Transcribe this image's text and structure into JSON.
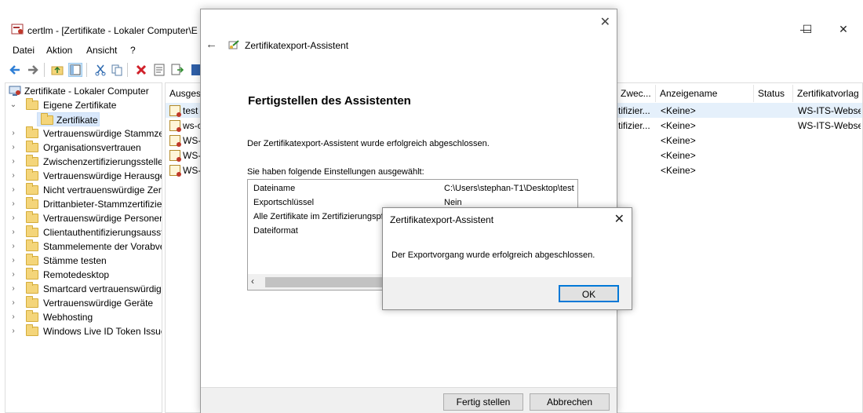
{
  "window": {
    "title": "certlm - [Zertifikate - Lokaler Computer\\E",
    "minimize": "—",
    "maximize": "☐",
    "close": "✕"
  },
  "menu": [
    "Datei",
    "Aktion",
    "Ansicht",
    "?"
  ],
  "tree": {
    "root": "Zertifikate - Lokaler Computer",
    "items": [
      {
        "label": "Eigene Zertifikate",
        "expanded": true
      },
      {
        "label": "Zertifikate",
        "child": true,
        "selected": true
      },
      {
        "label": "Vertrauenswürdige Stammzer"
      },
      {
        "label": "Organisationsvertrauen"
      },
      {
        "label": "Zwischenzertifizierungsstellen"
      },
      {
        "label": "Vertrauenswürdige Herausgeb"
      },
      {
        "label": "Nicht vertrauenswürdige Zerti"
      },
      {
        "label": "Drittanbieter-Stammzertifizie"
      },
      {
        "label": "Vertrauenswürdige Personen"
      },
      {
        "label": "Clientauthentifizierungsausst"
      },
      {
        "label": "Stammelemente der Vorabve"
      },
      {
        "label": "Stämme testen"
      },
      {
        "label": "Remotedesktop"
      },
      {
        "label": "Smartcard vertrauenswürdige"
      },
      {
        "label": "Vertrauenswürdige Geräte"
      },
      {
        "label": "Webhosting"
      },
      {
        "label": "Windows Live ID Token Issuer"
      }
    ]
  },
  "list": {
    "columns": [
      "Ausges",
      "Zwec...",
      "Anzeigename",
      "Status",
      "Zertifikatvorlag"
    ],
    "rows": [
      {
        "name": "test",
        "purpose": "tifizier...",
        "display": "<Keine>",
        "template": "WS-ITS-Webse"
      },
      {
        "name": "ws-c",
        "purpose": "tifizier...",
        "display": "<Keine>",
        "template": "WS-ITS-Webse"
      },
      {
        "name": "WS-",
        "purpose": "",
        "display": "<Keine>",
        "template": ""
      },
      {
        "name": "WS-",
        "purpose": "",
        "display": "<Keine>",
        "template": ""
      },
      {
        "name": "WS-",
        "purpose": "",
        "display": "<Keine>",
        "template": ""
      }
    ]
  },
  "wizard": {
    "title": "Zertifikatexport-Assistent",
    "heading": "Fertigstellen des Assistenten",
    "done_text": "Der Zertifikatexport-Assistent wurde erfolgreich abgeschlossen.",
    "settings_label": "Sie haben folgende Einstellungen ausgewählt:",
    "settings": [
      {
        "key": "Dateiname",
        "value": "C:\\Users\\stephan-T1\\Desktop\\test"
      },
      {
        "key": "Exportschlüssel",
        "value": "Nein"
      },
      {
        "key": "Alle Zertifikate im Zertifizierungspfa",
        "value": ""
      },
      {
        "key": "Dateiformat",
        "value": ""
      }
    ],
    "finish_button": "Fertig stellen",
    "cancel_button": "Abbrechen"
  },
  "msgbox": {
    "title": "Zertifikatexport-Assistent",
    "text": "Der Exportvorgang wurde erfolgreich abgeschlossen.",
    "ok": "OK"
  },
  "colors": {
    "selection": "#d9e8fb",
    "row_highlight": "#e5f0fb",
    "accent": "#0078d7"
  }
}
